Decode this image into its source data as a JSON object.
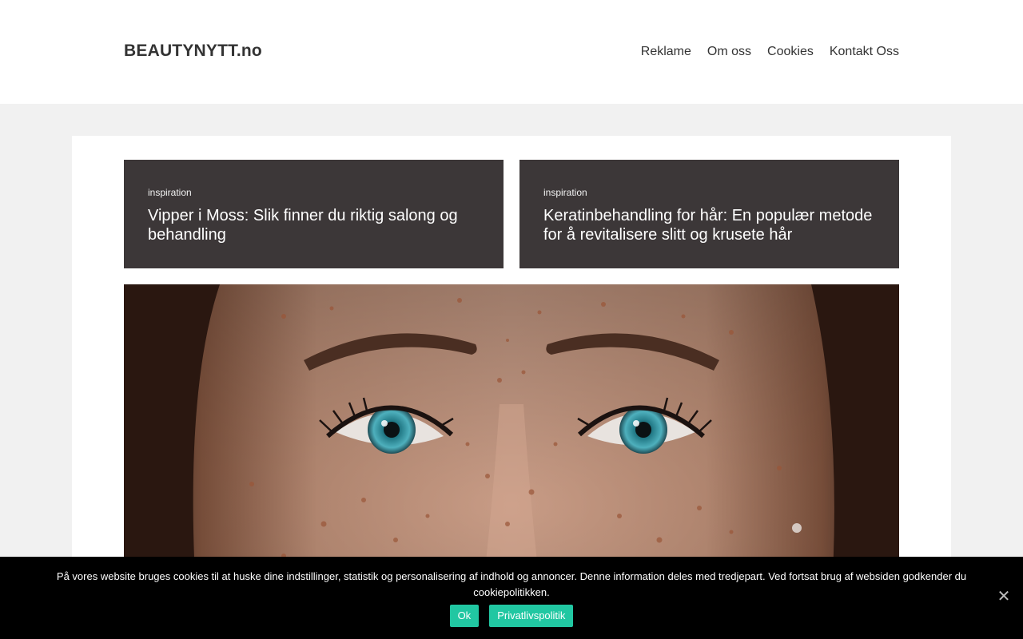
{
  "header": {
    "logo": "BEAUTYNYTT.no",
    "nav": [
      "Reklame",
      "Om oss",
      "Cookies",
      "Kontakt Oss"
    ]
  },
  "featured": [
    {
      "category": "inspiration",
      "title": "Vipper i Moss: Slik finner du riktig salong og behandling"
    },
    {
      "category": "inspiration",
      "title": "Keratinbehandling for hår: En populær metode for å revitalisere slitt og krusete hår"
    }
  ],
  "cookie": {
    "text": "På vores website bruges cookies til at huske dine indstillinger, statistik og personalisering af indhold og annoncer. Denne information deles med tredjepart. Ved fortsat brug af websiden godkender du cookiepolitikken.",
    "ok_label": "Ok",
    "privacy_label": "Privatlivspolitik",
    "close_icon": "close-icon"
  },
  "colors": {
    "card_bg": "#3c3738",
    "cookie_bg": "#000000",
    "button_accent": "#21c7a2"
  }
}
